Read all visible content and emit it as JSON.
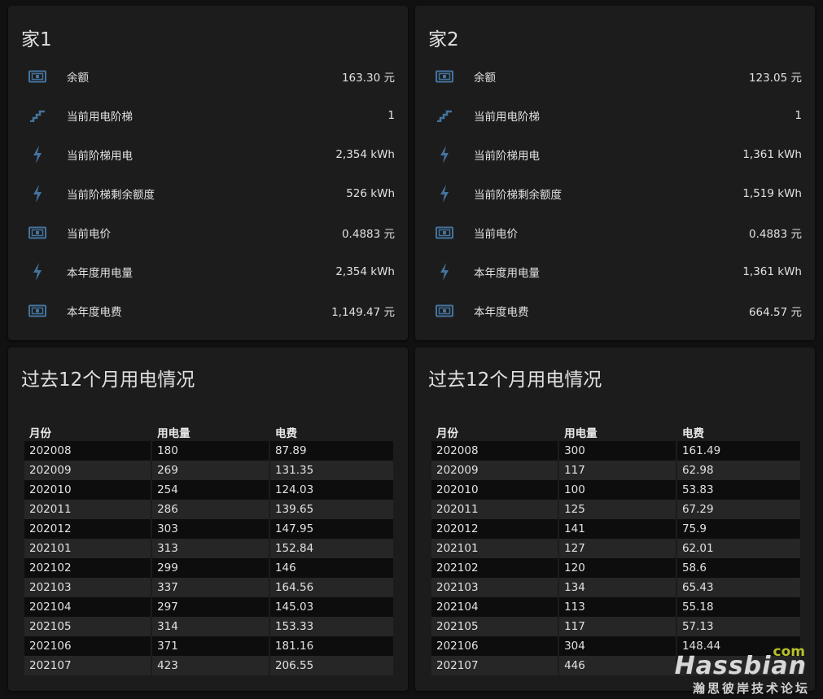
{
  "colors": {
    "icon": "#44739e",
    "card": "#1c1c1c",
    "background": "#111111"
  },
  "home1": {
    "title": "家1",
    "rows": [
      {
        "icon": "cash-icon",
        "name": "余额",
        "value": "163.30 元"
      },
      {
        "icon": "stairs-icon",
        "name": "当前用电阶梯",
        "value": "1"
      },
      {
        "icon": "flash-icon",
        "name": "当前阶梯用电",
        "value": "2,354 kWh"
      },
      {
        "icon": "flash-icon",
        "name": "当前阶梯剩余额度",
        "value": "526 kWh"
      },
      {
        "icon": "cash-icon",
        "name": "当前电价",
        "value": "0.4883 元"
      },
      {
        "icon": "flash-icon",
        "name": "本年度用电量",
        "value": "2,354 kWh"
      },
      {
        "icon": "cash-icon",
        "name": "本年度电费",
        "value": "1,149.47 元"
      }
    ]
  },
  "home2": {
    "title": "家2",
    "rows": [
      {
        "icon": "cash-icon",
        "name": "余额",
        "value": "123.05 元"
      },
      {
        "icon": "stairs-icon",
        "name": "当前用电阶梯",
        "value": "1"
      },
      {
        "icon": "flash-icon",
        "name": "当前阶梯用电",
        "value": "1,361 kWh"
      },
      {
        "icon": "flash-icon",
        "name": "当前阶梯剩余额度",
        "value": "1,519 kWh"
      },
      {
        "icon": "cash-icon",
        "name": "当前电价",
        "value": "0.4883 元"
      },
      {
        "icon": "flash-icon",
        "name": "本年度用电量",
        "value": "1,361 kWh"
      },
      {
        "icon": "cash-icon",
        "name": "本年度电费",
        "value": "664.57 元"
      }
    ]
  },
  "history1": {
    "title": "过去12个月用电情况",
    "headers": [
      "月份",
      "用电量",
      "电费"
    ],
    "rows": [
      [
        "202008",
        "180",
        "87.89"
      ],
      [
        "202009",
        "269",
        "131.35"
      ],
      [
        "202010",
        "254",
        "124.03"
      ],
      [
        "202011",
        "286",
        "139.65"
      ],
      [
        "202012",
        "303",
        "147.95"
      ],
      [
        "202101",
        "313",
        "152.84"
      ],
      [
        "202102",
        "299",
        "146"
      ],
      [
        "202103",
        "337",
        "164.56"
      ],
      [
        "202104",
        "297",
        "145.03"
      ],
      [
        "202105",
        "314",
        "153.33"
      ],
      [
        "202106",
        "371",
        "181.16"
      ],
      [
        "202107",
        "423",
        "206.55"
      ]
    ]
  },
  "history2": {
    "title": "过去12个月用电情况",
    "headers": [
      "月份",
      "用电量",
      "电费"
    ],
    "rows": [
      [
        "202008",
        "300",
        "161.49"
      ],
      [
        "202009",
        "117",
        "62.98"
      ],
      [
        "202010",
        "100",
        "53.83"
      ],
      [
        "202011",
        "125",
        "67.29"
      ],
      [
        "202012",
        "141",
        "75.9"
      ],
      [
        "202101",
        "127",
        "62.01"
      ],
      [
        "202102",
        "120",
        "58.6"
      ],
      [
        "202103",
        "134",
        "65.43"
      ],
      [
        "202104",
        "113",
        "55.18"
      ],
      [
        "202105",
        "117",
        "57.13"
      ],
      [
        "202106",
        "304",
        "148.44"
      ],
      [
        "202107",
        "446",
        ""
      ]
    ]
  },
  "watermark": {
    "com": "com",
    "main": "Hassbian",
    "sub": "瀚思彼岸技术论坛"
  }
}
